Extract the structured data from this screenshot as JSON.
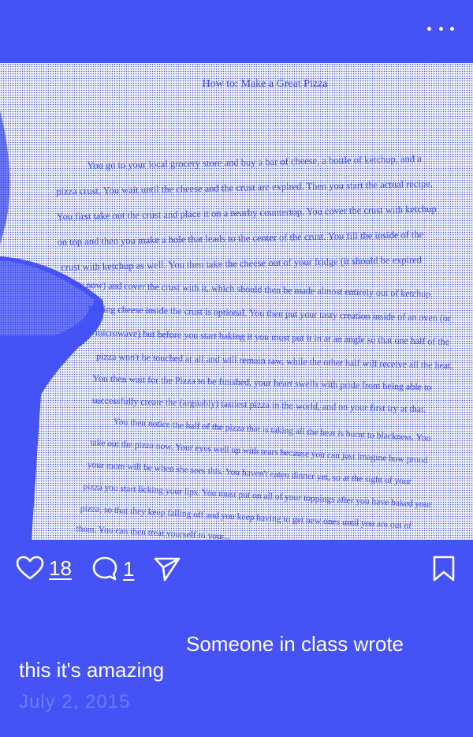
{
  "header": {
    "menu_icon": "more-horizontal-icon"
  },
  "photo": {
    "doc_title": "How to: Make a Great Pizza",
    "paragraph1": [
      "You go to your local grocery store and buy a bar of cheese, a bottle of ketchup, and a",
      "pizza crust. You wait until the cheese and the crust are expired. Then you start the actual recipe.",
      "You first take out the crust and place it on a nearby countertop. You cover the crust with ketchup",
      "on top and then you make a hole that leads to the center of the crust. You fill the inside of the",
      "crust with ketchup as well. You then take the cheese out of your fridge (it should be expired",
      "by now) and cover the crust with it, which should then be made almost entirely out of ketchup.",
      "Putting cheese inside the crust is optional. You then put your tasty creation inside of an oven (or",
      "microwave) but before you start baking it you must put it in at an angle so that one half of the",
      "pizza won't be touched at all and will remain raw, while the other half will receive all the heat.",
      "You then wait for the Pizza to be finished, your heart swells with pride from being able to",
      "successfully create the (arguably) tastiest pizza in the world, and on your first try at that."
    ],
    "paragraph2": [
      "You then notice the half of the pizza that is taking all the heat is burnt to blackness. You",
      "take out the pizza now. Your eyes well up with tears because you can just imagine how proud",
      "your mom will be when she sees this. You haven't eaten dinner yet, so at the sight of your",
      "pizza you start licking your lips. You must put on all of your toppings after you have baked your",
      "pizza, so that they keep falling off and you keep having to get new ones until you are out of",
      "them. You can then treat yourself to your..."
    ]
  },
  "actions": {
    "like_icon": "heart-icon",
    "like_count": "18",
    "comment_icon": "comment-icon",
    "comment_count": "1",
    "share_icon": "send-icon",
    "bookmark_icon": "bookmark-icon"
  },
  "post": {
    "caption": "Someone in class wrote this it's amazing",
    "caption_line1": "Someone in class wrote",
    "caption_line2": "this it's amazing",
    "date": "July 2, 2015"
  },
  "colors": {
    "background": "#4452f6",
    "text": "#ffffff",
    "date": "#6f7bf9",
    "ink": "#3b4af0"
  }
}
